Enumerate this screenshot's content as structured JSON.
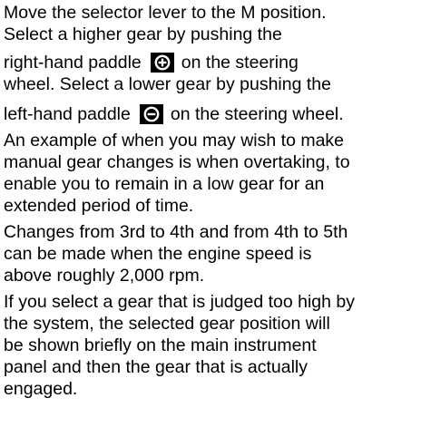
{
  "lines": {
    "l1": "Move the selector lever to the M position.",
    "l2": "Select a higher gear by pushing the",
    "l3a": "right-hand paddle",
    "l3b": "on the steering",
    "l4": "wheel. Select a lower gear by pushing the",
    "l5a": "left-hand paddle",
    "l5b": "on the steering wheel.",
    "l6": "An example of when you may wish to make",
    "l7": "manual gear changes is when overtaking, to",
    "l8": "enable you to remain in a low gear for an",
    "l9": "extended period of time.",
    "l10": "Changes from 3rd to 4th and from 4th to 5th",
    "l11": "can be made when the engine speed is",
    "l12": "above roughly 2,000 rpm.",
    "l13": "If you select a gear that is judged too high by",
    "l14": "the system, the selected gear position will",
    "l15": "be shown briefly on the main instrument",
    "l16": "panel and then the gear that is actually",
    "l17": "engaged."
  },
  "icons": {
    "upshift": "plus-paddle-icon",
    "downshift": "minus-paddle-icon"
  },
  "colors": {
    "text": "#000000",
    "background": "#ffffff",
    "icon_bg": "#000000",
    "icon_fg": "#ffffff"
  }
}
